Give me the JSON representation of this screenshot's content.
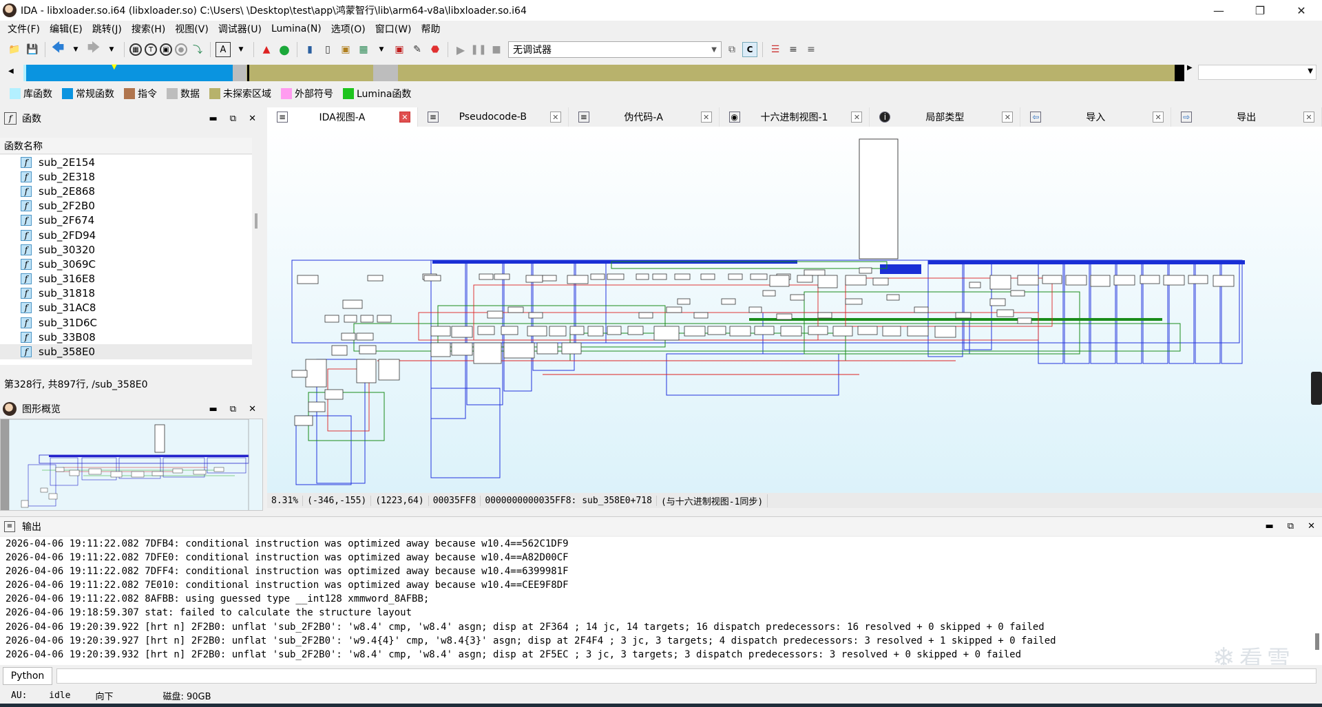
{
  "window": {
    "title": "IDA - libxloader.so.i64 (libxloader.so) C:\\Users\\ \\Desktop\\test\\app\\鸿蒙智行\\lib\\arm64-v8a\\libxloader.so.i64"
  },
  "menu": [
    "文件(F)",
    "编辑(E)",
    "跳转(J)",
    "搜索(H)",
    "视图(V)",
    "调试器(U)",
    "Lumina(N)",
    "选项(O)",
    "窗口(W)",
    "帮助"
  ],
  "toolbar": {
    "debugger_select": "无调试器"
  },
  "legend": [
    {
      "label": "库函数",
      "color": "#b3f0ff"
    },
    {
      "label": "常规函数",
      "color": "#0a94e0"
    },
    {
      "label": "指令",
      "color": "#b0754e"
    },
    {
      "label": "数据",
      "color": "#bdbdbd"
    },
    {
      "label": "未探索区域",
      "color": "#b7b26b"
    },
    {
      "label": "外部符号",
      "color": "#ff9cf0"
    },
    {
      "label": "Lumina函数",
      "color": "#1ec41e"
    }
  ],
  "functions_panel": {
    "title": "函数",
    "column": "函数名称",
    "items": [
      "sub_2E154",
      "sub_2E318",
      "sub_2E868",
      "sub_2F2B0",
      "sub_2F674",
      "sub_2FD94",
      "sub_30320",
      "sub_3069C",
      "sub_316E8",
      "sub_31818",
      "sub_31AC8",
      "sub_31D6C",
      "sub_33B08",
      "sub_358E0"
    ],
    "selected": "sub_358E0",
    "status": "第328行, 共897行, /sub_358E0"
  },
  "overview_panel": {
    "title": "图形概览"
  },
  "tabs": [
    {
      "label": "IDA视图-A",
      "icon": "list-icon",
      "active": true
    },
    {
      "label": "Pseudocode-B",
      "icon": "list-icon",
      "active": false
    },
    {
      "label": "伪代码-A",
      "icon": "list-icon",
      "active": false
    },
    {
      "label": "十六进制视图-1",
      "icon": "hex-icon",
      "active": false
    },
    {
      "label": "局部类型",
      "icon": "info-icon",
      "active": false
    },
    {
      "label": "导入",
      "icon": "import-icon",
      "active": false
    },
    {
      "label": "导出",
      "icon": "export-icon",
      "active": false
    }
  ],
  "graph_status": {
    "zoom": "8.31%",
    "mouse": "(-346,-155)",
    "pos": "(1223,64)",
    "offset": "00035FF8",
    "address": "0000000000035FF8: sub_358E0+718",
    "sync": "(与十六进制视图-1同步)"
  },
  "output_panel": {
    "title": "输出",
    "lines": [
      "2026-04-06 19:11:22.082 7DFB4: conditional instruction was optimized away because w10.4==562C1DF9",
      "2026-04-06 19:11:22.082 7DFE0: conditional instruction was optimized away because w10.4==A82D00CF",
      "2026-04-06 19:11:22.082 7DFF4: conditional instruction was optimized away because w10.4==6399981F",
      "2026-04-06 19:11:22.082 7E010: conditional instruction was optimized away because w10.4==CEE9F8DF",
      "2026-04-06 19:11:22.082 8AFBB: using guessed type __int128 xmmword_8AFBB;",
      "2026-04-06 19:18:59.307 stat: failed to calculate the structure layout",
      "2026-04-06 19:20:39.922 [hrt n] 2F2B0: unflat 'sub_2F2B0': 'w8.4' cmp, 'w8.4' asgn; disp at 2F364 ; 14 jc, 14 targets; 16 dispatch predecessors: 16 resolved + 0 skipped + 0 failed",
      "2026-04-06 19:20:39.927 [hrt n] 2F2B0: unflat 'sub_2F2B0': 'w9.4{4}' cmp, 'w8.4{3}' asgn; disp at 2F4F4 ; 3 jc, 3 targets; 4 dispatch predecessors: 3 resolved + 1 skipped + 0 failed",
      "2026-04-06 19:20:39.932 [hrt n] 2F2B0: unflat 'sub_2F2B0': 'w8.4' cmp, 'w8.4' asgn; disp at 2F5EC ; 3 jc, 3 targets; 3 dispatch predecessors: 3 resolved + 0 skipped + 0 failed"
    ]
  },
  "python": {
    "label": "Python"
  },
  "statusbar": {
    "au_label": "AU:",
    "au_state": "idle",
    "direction": "向下",
    "disk": "磁盘: 90GB"
  },
  "watermark": "看雪"
}
